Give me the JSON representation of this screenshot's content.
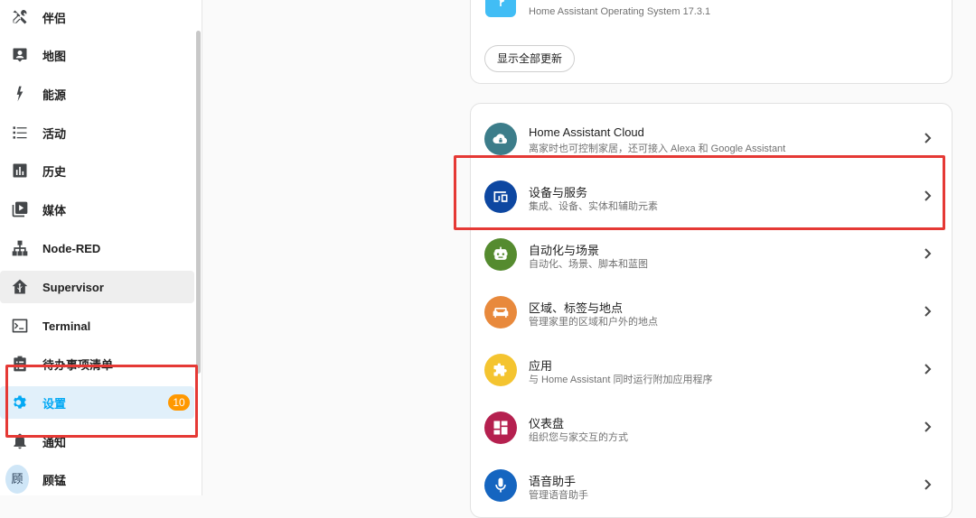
{
  "sidebar": {
    "items": [
      {
        "label": "伴侣",
        "icon": "tools-icon"
      },
      {
        "label": "地图",
        "icon": "map-account-icon"
      },
      {
        "label": "能源",
        "icon": "lightning-icon"
      },
      {
        "label": "活动",
        "icon": "list-icon"
      },
      {
        "label": "历史",
        "icon": "chart-bar-icon"
      },
      {
        "label": "媒体",
        "icon": "play-box-icon"
      },
      {
        "label": "Node-RED",
        "icon": "sitemap-icon"
      },
      {
        "label": "Supervisor",
        "icon": "home-assistant-icon"
      },
      {
        "label": "Terminal",
        "icon": "console-icon"
      },
      {
        "label": "待办事项清单",
        "icon": "clipboard-list-icon"
      },
      {
        "label": "设置",
        "icon": "gear-icon",
        "badge": "10"
      },
      {
        "label": "通知",
        "icon": "bell-icon"
      },
      {
        "label": "顾锰",
        "icon": "avatar",
        "avatar_text": "顾"
      }
    ]
  },
  "updates_card": {
    "os_subtitle": "Home Assistant Operating System 17.3.1",
    "show_all_updates": "显示全部更新"
  },
  "settings_card": {
    "rows": [
      {
        "title": "Home Assistant Cloud",
        "subtitle": "离家时也可控制家居，还可接入 Alexa 和 Google Assistant",
        "icon": "cloud-lock-icon",
        "color": "#3c7d8a"
      },
      {
        "title": "设备与服务",
        "subtitle": "集成、设备、实体和辅助元素",
        "icon": "devices-icon",
        "color": "#0d47a1"
      },
      {
        "title": "自动化与场景",
        "subtitle": "自动化、场景、脚本和蓝图",
        "icon": "robot-icon",
        "color": "#558b2f"
      },
      {
        "title": "区域、标签与地点",
        "subtitle": "管理家里的区域和户外的地点",
        "icon": "sofa-icon",
        "color": "#e8893c"
      },
      {
        "title": "应用",
        "subtitle": "与 Home Assistant 同时运行附加应用程序",
        "icon": "puzzle-icon",
        "color": "#f4c430"
      },
      {
        "title": "仪表盘",
        "subtitle": "组织您与家交互的方式",
        "icon": "view-dashboard-icon",
        "color": "#b5204f"
      },
      {
        "title": "语音助手",
        "subtitle": "管理语音助手",
        "icon": "microphone-icon",
        "color": "#1565c0"
      }
    ]
  },
  "colors": {
    "accent": "#03a9f4",
    "badge": "#ff9800",
    "highlight_box": "#e53935"
  }
}
